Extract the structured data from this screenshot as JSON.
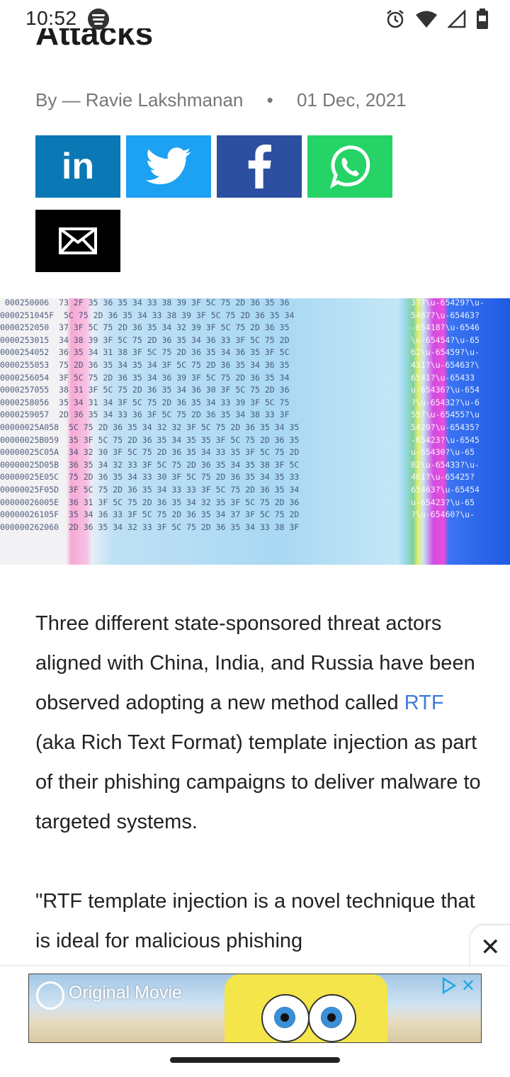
{
  "status_bar": {
    "time": "10:52",
    "icons": [
      "spotify-icon",
      "alarm-icon",
      "wifi-icon",
      "signal-icon",
      "battery-icon"
    ]
  },
  "article": {
    "title_fragment": "Attacks",
    "byline": "By — Ravie Lakshmanan",
    "separator": "•",
    "date": "01 Dec, 2021",
    "paragraph1_before_link": "Three different state-sponsored threat actors aligned with China, India, and Russia have been observed adopting a new method called ",
    "paragraph1_link": "RTF",
    "paragraph1_after_link": " (aka Rich Text Format) template injection as part of their phishing campaigns to deliver malware to targeted systems.",
    "paragraph2": "\"RTF template injection is a novel technique that is ideal for malicious phishing"
  },
  "share": {
    "linkedin_label": "in",
    "colors": {
      "linkedin": "#0a78b5",
      "twitter": "#1da1f2",
      "facebook": "#2d4fa0",
      "whatsapp": "#25d366",
      "email": "#000000"
    }
  },
  "ad": {
    "brand_text": "Original Movie",
    "close_symbol": "✕"
  },
  "theme": {
    "link_color": "#3d7bd9"
  }
}
